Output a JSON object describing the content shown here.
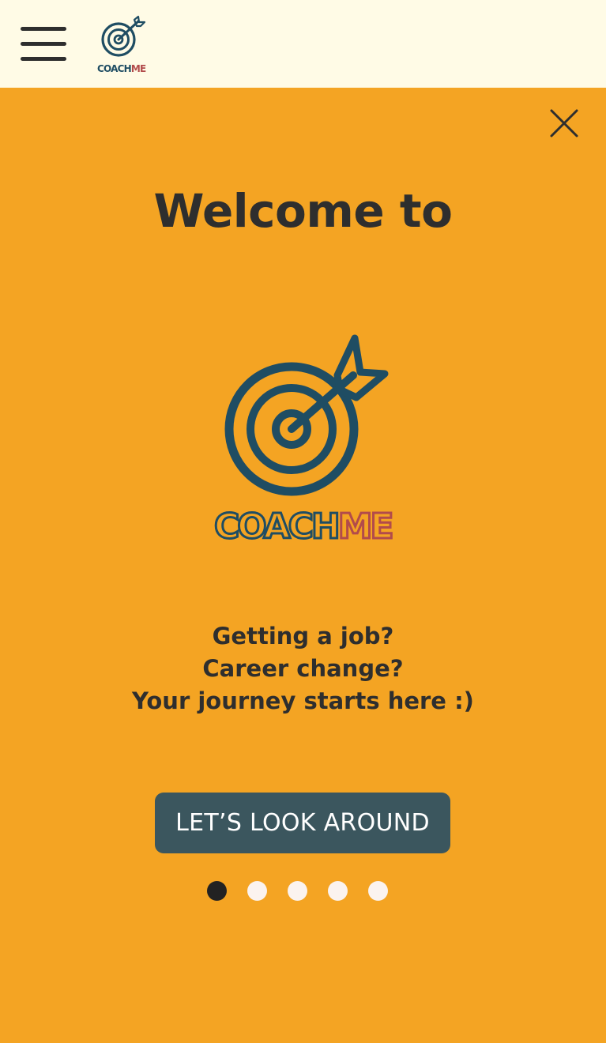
{
  "header": {
    "logo": {
      "brand_part1": "COACH",
      "brand_part2": "ME"
    }
  },
  "onboarding": {
    "title": "Welcome to",
    "logo": {
      "brand_part1": "COACH",
      "brand_part2": "ME"
    },
    "tagline": [
      "Getting a job?",
      "Career change?",
      "Your journey starts here :)"
    ],
    "cta_label": "LET’S LOOK AROUND",
    "pagination": {
      "total": 5,
      "current": 1
    }
  },
  "colors": {
    "overlay_bg": "#F4A423",
    "topbar_bg": "#FFFBE6",
    "logo_blue": "#1F4D63",
    "logo_red": "#B24B4B",
    "button_bg": "#3B565E",
    "text_dark": "#2E2E2E"
  },
  "icons": {
    "menu": "hamburger-menu-icon",
    "close": "close-icon",
    "logo": "target-arrow-icon"
  }
}
